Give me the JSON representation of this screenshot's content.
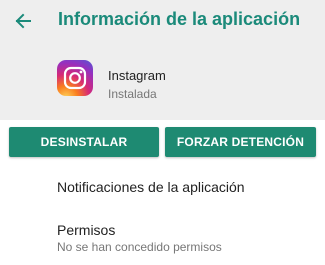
{
  "colors": {
    "accent": "#1b8a7a",
    "button": "#1e8a72",
    "header_bg": "#eeeeee"
  },
  "header": {
    "back_icon": "arrow-left-icon",
    "title": "Información de la aplicación"
  },
  "app": {
    "icon": "instagram-icon",
    "name": "Instagram",
    "status": "Instalada"
  },
  "actions": {
    "uninstall_label": "DESINSTALAR",
    "force_stop_label": "FORZAR DETENCIÓN"
  },
  "settings": {
    "notifications_label": "Notificaciones de la aplicación",
    "permissions_label": "Permisos",
    "permissions_summary": "No se han concedido permisos"
  }
}
